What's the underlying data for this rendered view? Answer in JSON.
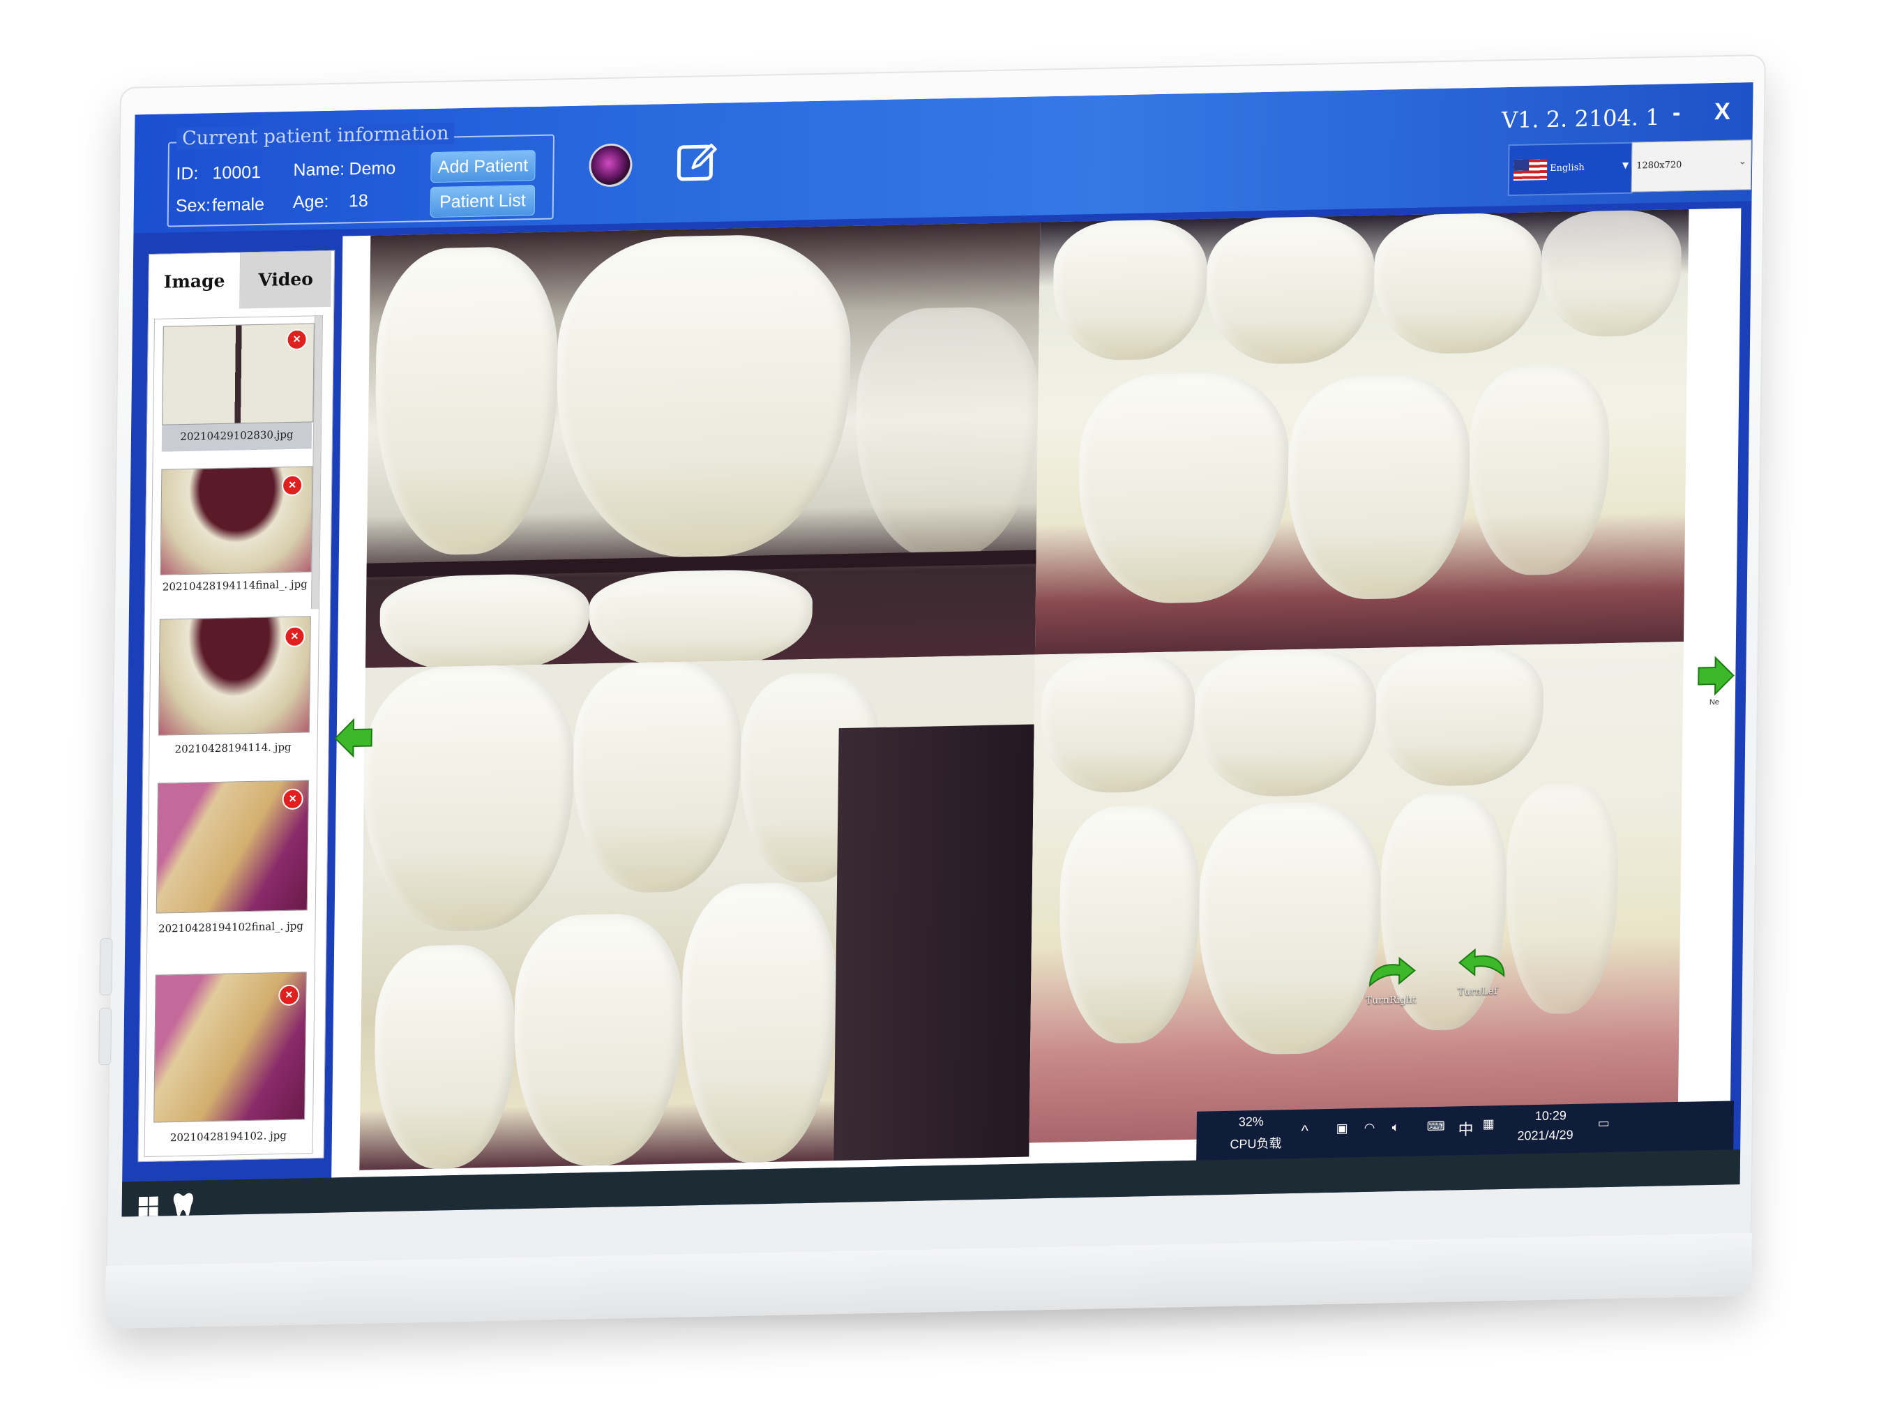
{
  "app": {
    "version": "V1. 2. 2104. 1",
    "minimize": "-",
    "close": "X"
  },
  "patient": {
    "legend": "Current patient information",
    "id_label": "ID:",
    "id_value": "10001",
    "name_label": "Name:",
    "name_value": "Demo",
    "sex_label": "Sex:",
    "sex_value": "female",
    "age_label": "Age:",
    "age_value": "18",
    "add_button": "Add Patient",
    "list_button": "Patient List"
  },
  "settings": {
    "language": "English",
    "resolution": "1280x720"
  },
  "tabs": {
    "image": "Image",
    "video": "Video"
  },
  "thumbnails": [
    {
      "name": "20210429102830.jpg"
    },
    {
      "name": "20210428194114final_. jpg"
    },
    {
      "name": "20210428194114. jpg"
    },
    {
      "name": "20210428194102final_. jpg"
    },
    {
      "name": "20210428194102. jpg"
    }
  ],
  "viewer": {
    "next_label": "Ne",
    "turn_right": "TurnRight",
    "turn_left": "TurnLef"
  },
  "tray": {
    "cpu_percent": "32%",
    "cpu_label": "CPU负载",
    "ime": "中",
    "time": "10:29",
    "date": "2021/4/29"
  },
  "colors": {
    "title_bar": "#1b4fd0",
    "button": "#4c95e4",
    "delete_badge": "#e0201e",
    "nav_arrow": "#3cb82a"
  }
}
